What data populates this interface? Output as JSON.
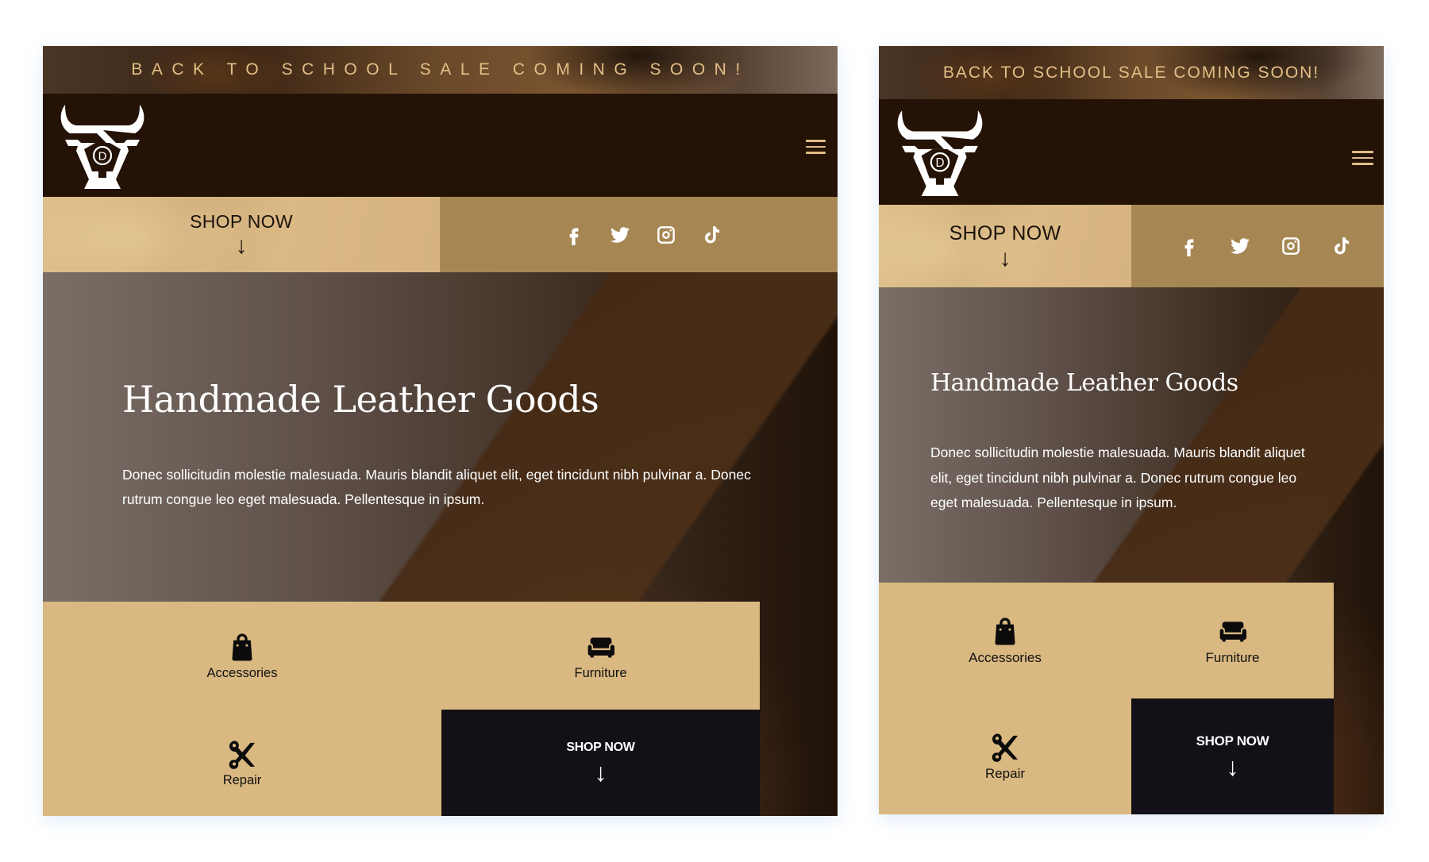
{
  "banner": {
    "text": "BACK TO SCHOOL SALE COMING SOON!"
  },
  "header": {
    "logo": "bull-logo-icon",
    "menu_icon": "hamburger-menu-icon"
  },
  "strip": {
    "shop_label": "SHOP NOW",
    "shop_arrow": "↓",
    "socials": [
      {
        "name": "facebook",
        "icon": "facebook-icon"
      },
      {
        "name": "twitter",
        "icon": "twitter-icon"
      },
      {
        "name": "instagram",
        "icon": "instagram-icon"
      },
      {
        "name": "tiktok",
        "icon": "tiktok-icon"
      }
    ]
  },
  "hero": {
    "title": "Handmade Leather Goods",
    "text": "Donec sollicitudin molestie malesuada. Mauris blandit aliquet elit, eget tincidunt nibh pulvinar a. Donec rutrum congue leo eget malesuada. Pellentesque in ipsum."
  },
  "categories": [
    {
      "label": "Accessories",
      "icon": "shopping-bag-icon"
    },
    {
      "label": "Furniture",
      "icon": "armchair-icon"
    },
    {
      "label": "Repair",
      "icon": "scissors-icon"
    },
    {
      "label": "SHOP NOW",
      "icon": "arrow-down-icon",
      "arrow": "↓"
    }
  ],
  "colors": {
    "header_bg": "#241206",
    "banner_text": "#e3bf87",
    "tan": "#d9b881",
    "social_strip": "#a68754",
    "dark_cta": "#121117"
  }
}
